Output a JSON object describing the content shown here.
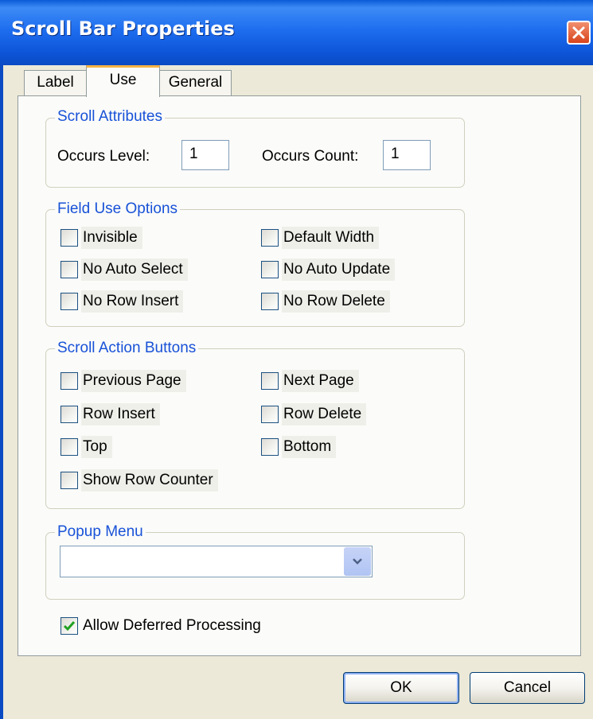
{
  "window": {
    "title": "Scroll Bar Properties"
  },
  "tabs": [
    {
      "label": "Label",
      "active": false
    },
    {
      "label": "Use",
      "active": true
    },
    {
      "label": "General",
      "active": false
    }
  ],
  "scroll_attributes": {
    "legend": "Scroll Attributes",
    "occurs_level_label": "Occurs Level:",
    "occurs_level_value": "1",
    "occurs_count_label": "Occurs Count:",
    "occurs_count_value": "1"
  },
  "field_use_options": {
    "legend": "Field Use Options",
    "items": [
      {
        "label": "Invisible",
        "checked": false
      },
      {
        "label": "Default Width",
        "checked": false
      },
      {
        "label": "No Auto Select",
        "checked": false
      },
      {
        "label": "No Auto Update",
        "checked": false
      },
      {
        "label": "No Row Insert",
        "checked": false
      },
      {
        "label": "No Row Delete",
        "checked": false
      }
    ]
  },
  "scroll_action_buttons": {
    "legend": "Scroll Action Buttons",
    "items": [
      {
        "label": "Previous Page",
        "checked": false
      },
      {
        "label": "Next Page",
        "checked": false
      },
      {
        "label": "Row Insert",
        "checked": false
      },
      {
        "label": "Row Delete",
        "checked": false
      },
      {
        "label": "Top",
        "checked": false
      },
      {
        "label": "Bottom",
        "checked": false
      },
      {
        "label": "Show Row Counter",
        "checked": false
      }
    ]
  },
  "popup_menu": {
    "legend": "Popup Menu",
    "selected": ""
  },
  "allow_deferred": {
    "label": "Allow Deferred Processing",
    "checked": true
  },
  "buttons": {
    "ok": "OK",
    "cancel": "Cancel"
  },
  "colors": {
    "title_bar": "#1f6ef0",
    "legend_text": "#1852d8",
    "check_mark": "#21a121",
    "close_button": "#d8441d"
  }
}
